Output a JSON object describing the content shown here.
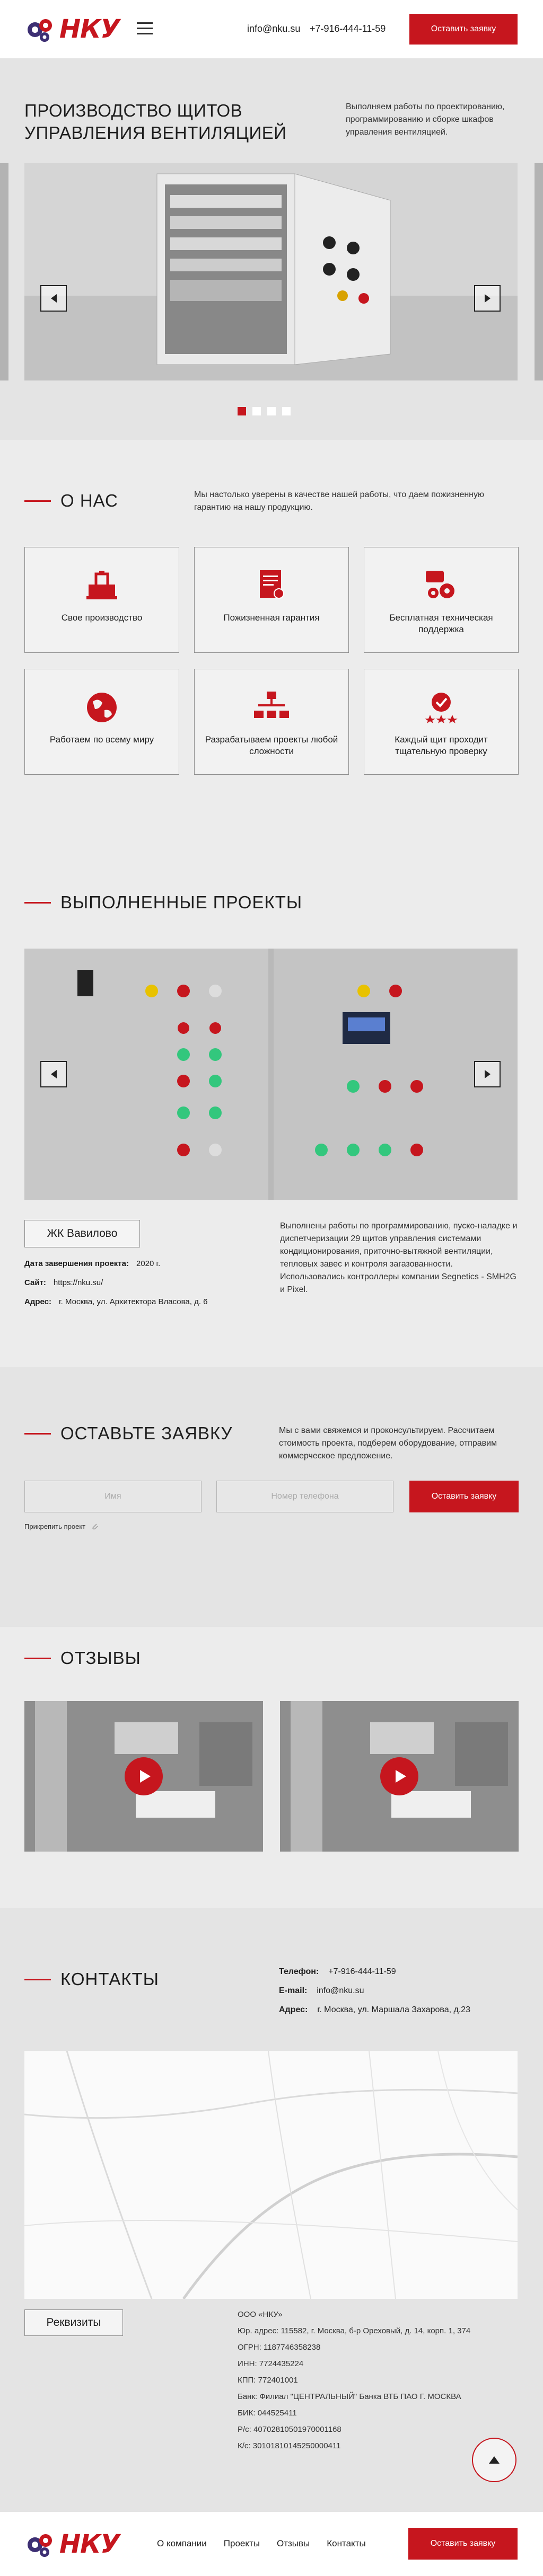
{
  "brand": {
    "logo_text": "НКУ",
    "red": "#c6161e",
    "dark": "#1e1e1e"
  },
  "header": {
    "email": "info@nku.su",
    "phone": "+7-916-444-11-59",
    "cta": "Оставить заявку",
    "menu_icon": "menu-icon"
  },
  "hero": {
    "title": "ПРОИЗВОДСТВО ЩИТОВ УПРАВЛЕНИЯ ВЕНТИЛЯЦИЕЙ",
    "description": "Выполняем работы по проектированию, программированию и сборке шкафов управления вентиляцией.",
    "slides_total": 4,
    "active_slide": 1
  },
  "about": {
    "title": "О НАС",
    "description": "Мы настолько уверены в качестве нашей работы, что даем пожизненную гарантию на нашу продукцию.",
    "cards": [
      {
        "label": "Свое производство",
        "icon": "factory-icon"
      },
      {
        "label": "Пожизненная гарантия",
        "icon": "certificate-icon"
      },
      {
        "label": "Бесплатная техническая поддержка",
        "icon": "support-gears-icon"
      },
      {
        "label": "Работаем по всему миру",
        "icon": "globe-icon"
      },
      {
        "label": "Разрабатываем проекты любой сложности",
        "icon": "hierarchy-icon"
      },
      {
        "label": "Каждый щит проходит тщательную проверку",
        "icon": "quality-check-icon"
      }
    ]
  },
  "projects": {
    "title": "ВЫПОЛНЕННЫЕ ПРОЕКТЫ",
    "name": "ЖК Вавилово",
    "completion_label": "Дата завершения проекта:",
    "completion_value": "2020 г.",
    "site_label": "Сайт:",
    "site_value": "https://nku.su/",
    "address_label": "Адрес:",
    "address_value": "г. Москва, ул. Архитектора Власова, д. 6",
    "description": "Выполнены работы по программированию, пуско-наладке и диспетчеризации 29 щитов управления системами кондиционирования, приточно-вытяжной вентиляции, тепловых завес и контроля загазованности. Использовались контроллеры компании Segnetics - SMH2G и Pixel."
  },
  "request": {
    "title": "ОСТАВЬТЕ ЗАЯВКУ",
    "description": "Мы с вами свяжемся и проконсультируем. Рассчитаем стоимость проекта, подберем оборудование, отправим коммерческое предложение.",
    "name_placeholder": "Имя",
    "phone_placeholder": "Номер телефона",
    "submit": "Оставить заявку",
    "consent": "Прикрепить проект"
  },
  "reviews": {
    "title": "ОТЗЫВЫ",
    "videos": 2
  },
  "contacts": {
    "title": "КОНТАКТЫ",
    "phone_label": "Телефон:",
    "phone_value": "+7-916-444-11-59",
    "email_label": "E-mail:",
    "email_value": "info@nku.su",
    "address_label": "Адрес:",
    "address_value": "г. Москва, ул. Маршала Захарова, д.23",
    "requisites_button": "Реквизиты",
    "requisites": [
      "ООО «НКУ»",
      "Юр. адрес: 115582, г. Москва, б-р Ореховый, д. 14, корп. 1, 374",
      "ОГРН: 1187746358238",
      "ИНН: 7724435224",
      "КПП: 772401001",
      "Банк: Филиал \"ЦЕНТРАЛЬНЫЙ\" Банка ВТБ ПАО Г. МОСКВА",
      "БИК: 044525411",
      "Р/с: 40702810501970001168",
      "К/с: 30101810145250000411"
    ]
  },
  "footer": {
    "nav": [
      "О компании",
      "Проекты",
      "Отзывы",
      "Контакты"
    ],
    "cta": "Оставить заявку"
  }
}
